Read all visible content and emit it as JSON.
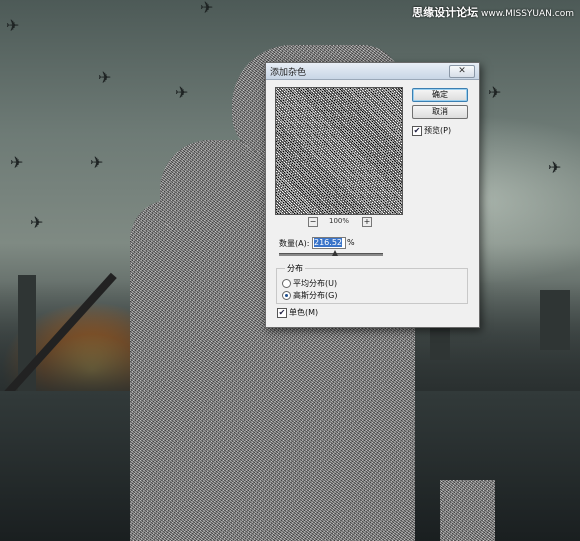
{
  "watermark": {
    "site": "思缘设计论坛",
    "url": "www.MISSYUAN.com"
  },
  "dialog": {
    "title": "添加杂色",
    "close_icon": "close-icon",
    "buttons": {
      "ok": "确定",
      "cancel": "取消"
    },
    "preview_label": "预览(P)",
    "preview_checked": true,
    "zoom": {
      "minus": "−",
      "plus": "+",
      "level": "100%"
    },
    "amount": {
      "label": "数量(A):",
      "value": "216.52",
      "unit": "%"
    },
    "amount_slider_fraction": 0.54,
    "distribution": {
      "title": "分布",
      "options": [
        {
          "label": "平均分布(U)",
          "selected": false
        },
        {
          "label": "高斯分布(G)",
          "selected": true
        }
      ]
    },
    "mono_label": "单色(M)",
    "mono_checked": true
  },
  "colors": {
    "title_bar": "#c8d6e6",
    "accent": "#3a74c9",
    "dialog_bg": "#f0f0f0"
  }
}
